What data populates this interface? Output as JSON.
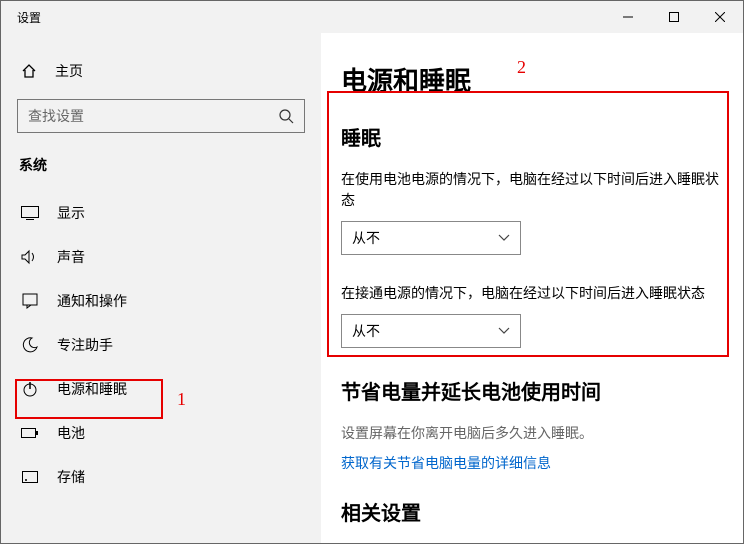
{
  "window": {
    "title": "设置"
  },
  "sidebar": {
    "home": "主页",
    "search_placeholder": "查找设置",
    "category": "系统",
    "items": [
      {
        "label": "显示"
      },
      {
        "label": "声音"
      },
      {
        "label": "通知和操作"
      },
      {
        "label": "专注助手"
      },
      {
        "label": "电源和睡眠"
      },
      {
        "label": "电池"
      },
      {
        "label": "存储"
      }
    ]
  },
  "main": {
    "title": "电源和睡眠",
    "sleep": {
      "heading": "睡眠",
      "battery_label": "在使用电池电源的情况下，电脑在经过以下时间后进入睡眠状态",
      "battery_value": "从不",
      "plugged_label": "在接通电源的情况下，电脑在经过以下时间后进入睡眠状态",
      "plugged_value": "从不"
    },
    "save": {
      "heading": "节省电量并延长电池使用时间",
      "desc": "设置屏幕在你离开电脑后多久进入睡眠。",
      "link": "获取有关节省电脑电量的详细信息"
    },
    "related": {
      "heading": "相关设置"
    }
  },
  "annotations": {
    "n1": "1",
    "n2": "2"
  }
}
